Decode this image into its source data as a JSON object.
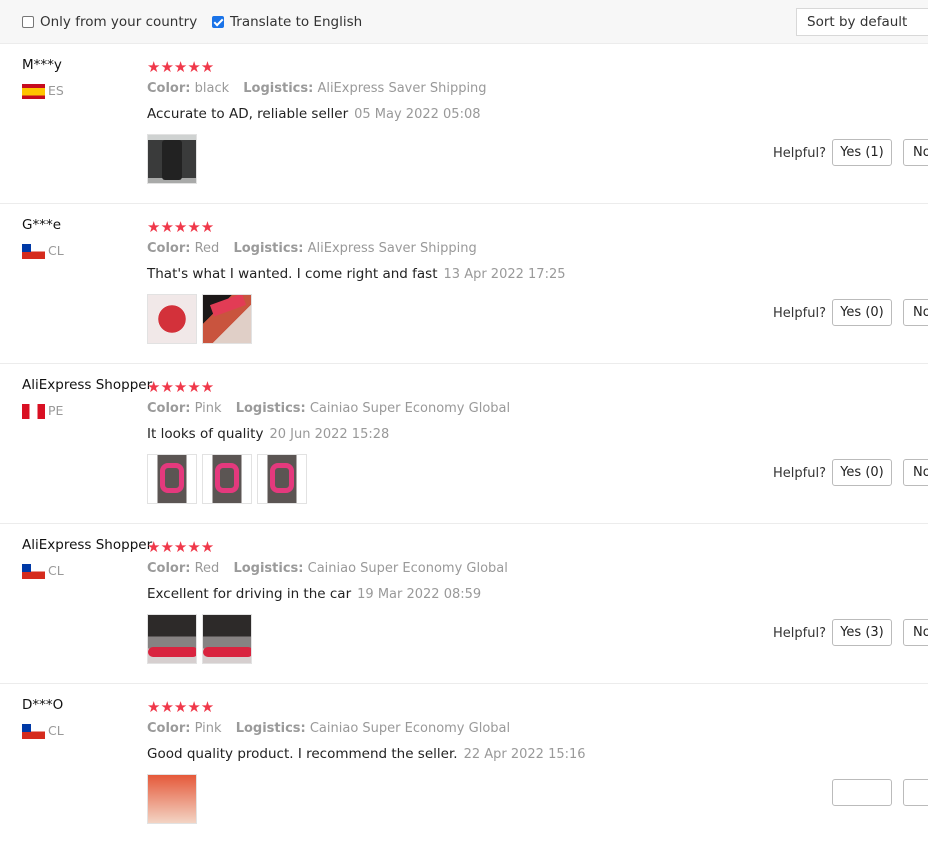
{
  "filters": {
    "only_country_label": "Only from your country",
    "only_country_checked": false,
    "translate_label": "Translate to English",
    "translate_checked": true,
    "sort_label": "Sort by default"
  },
  "helpful_label": "Helpful?",
  "no_label": "No",
  "stars": "★★★★★",
  "reviews": [
    {
      "name": "M***y",
      "country": "ES",
      "flag": "flag-es",
      "attr_name": "Color:",
      "attr_value": "black",
      "logistics_label": "Logistics:",
      "logistics_value": "AliExpress Saver Shipping",
      "text": "Accurate to AD, reliable seller",
      "date": "05 May 2022 05:08",
      "yes_label": "Yes (1)",
      "images": [
        "seat photo"
      ]
    },
    {
      "name": "G***e",
      "country": "CL",
      "flag": "flag-cl",
      "attr_name": "Color:",
      "attr_value": "Red",
      "logistics_label": "Logistics:",
      "logistics_value": "AliExpress Saver Shipping",
      "text": "That's what I wanted. I come right and fast",
      "date": "13 Apr 2022 17:25",
      "yes_label": "Yes (0)",
      "images": [
        "red product photo",
        "red product photo 2"
      ]
    },
    {
      "name": "AliExpress Shopper",
      "country": "PE",
      "flag": "flag-pe",
      "attr_name": "Color:",
      "attr_value": "Pink",
      "logistics_label": "Logistics:",
      "logistics_value": "Cainiao Super Economy Global",
      "text": "It looks of quality",
      "date": "20 Jun 2022 15:28",
      "yes_label": "Yes (0)",
      "images": [
        "pink product photo",
        "pink product photo 2",
        "pink product photo 3"
      ]
    },
    {
      "name": "AliExpress Shopper",
      "country": "CL",
      "flag": "flag-cl",
      "attr_name": "Color:",
      "attr_value": "Red",
      "logistics_label": "Logistics:",
      "logistics_value": "Cainiao Super Economy Global",
      "text": "Excellent for driving in the car",
      "date": "19 Mar 2022 08:59",
      "yes_label": "Yes (3)",
      "images": [
        "car seat photo",
        "car seat photo 2"
      ]
    },
    {
      "name": "D***O",
      "country": "CL",
      "flag": "flag-cl",
      "attr_name": "Color:",
      "attr_value": "Pink",
      "logistics_label": "Logistics:",
      "logistics_value": "Cainiao Super Economy Global",
      "text": "Good quality product. I recommend the seller.",
      "date": "22 Apr 2022 15:16",
      "yes_label": "",
      "images": [
        "product photo"
      ]
    }
  ]
}
